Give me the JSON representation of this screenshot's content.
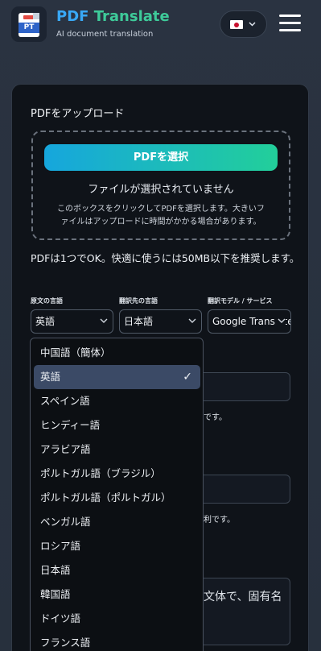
{
  "header": {
    "logo_text": "PT",
    "brand_part1": "PDF",
    "brand_part2": "Translate",
    "subtitle": "AI document translation",
    "language_flag": "japan-flag",
    "language_chevron": "⌄",
    "menu_icon": "hamburger-menu-icon"
  },
  "upload": {
    "heading": "PDFをアップロード",
    "select_button": "PDFを選択",
    "no_file": "ファイルが選択されていません",
    "help_line1": "このボックスをクリックしてPDFを選択します。大きいフ",
    "help_line2": "ァイルはアップロードに時間がかかる場合があります。",
    "limit_note": "PDFは1つでOK。快適に使うには50MB以下を推奨します。"
  },
  "options": {
    "source_label": "原文の言語",
    "source_value": "英語",
    "target_label": "翻訳先の言語",
    "target_value": "日本語",
    "model_label": "翻訳モデル / サービス",
    "model_value": "Google Translate"
  },
  "background_fragments": {
    "hint1": "利です。",
    "hint2": "便利です。",
    "textarea_fragment": "文体で、固有名"
  },
  "dropdown": {
    "items": [
      "中国語（簡体）",
      "英語",
      "スペイン語",
      "ヒンディー語",
      "アラビア語",
      "ポルトガル語（ブラジル）",
      "ポルトガル語（ポルトガル）",
      "ベンガル語",
      "ロシア語",
      "日本語",
      "韓国語",
      "ドイツ語",
      "フランス語"
    ],
    "selected": "英語",
    "check": "✓"
  },
  "colors": {
    "accent_blue": "#39a8f5",
    "accent_green": "#3ecb9a",
    "selected_row": "#3b4a66"
  }
}
